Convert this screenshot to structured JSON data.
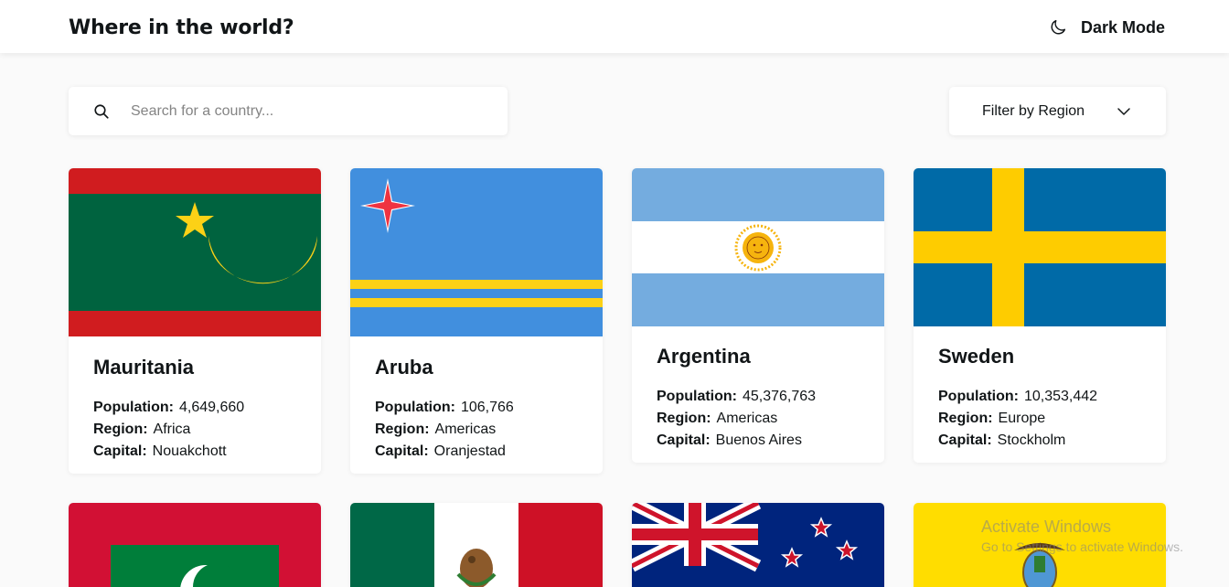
{
  "header": {
    "title": "Where in the world?",
    "mode_icon": "moon-icon",
    "mode_label": "Dark Mode"
  },
  "search": {
    "icon": "search-icon",
    "placeholder": "Search for a country...",
    "value": ""
  },
  "filter": {
    "label": "Filter by Region",
    "icon": "chevron-down-icon"
  },
  "labels": {
    "population": "Population:",
    "region": "Region:",
    "capital": "Capital:"
  },
  "countries": [
    {
      "name": "Mauritania",
      "population": "4,649,660",
      "region": "Africa",
      "capital": "Nouakchott"
    },
    {
      "name": "Aruba",
      "population": "106,766",
      "region": "Americas",
      "capital": "Oranjestad"
    },
    {
      "name": "Argentina",
      "population": "45,376,763",
      "region": "Americas",
      "capital": "Buenos Aires"
    },
    {
      "name": "Sweden",
      "population": "10,353,442",
      "region": "Europe",
      "capital": "Stockholm"
    }
  ],
  "more_flags": [
    "Maldives",
    "Mexico",
    "New Zealand",
    "Ecuador"
  ],
  "watermark": {
    "line1": "Activate Windows",
    "line2": "Go to Settings to activate Windows."
  },
  "colors": {
    "background": "#fafafa",
    "card": "#ffffff",
    "text": "#111517",
    "placeholder": "#848484"
  }
}
